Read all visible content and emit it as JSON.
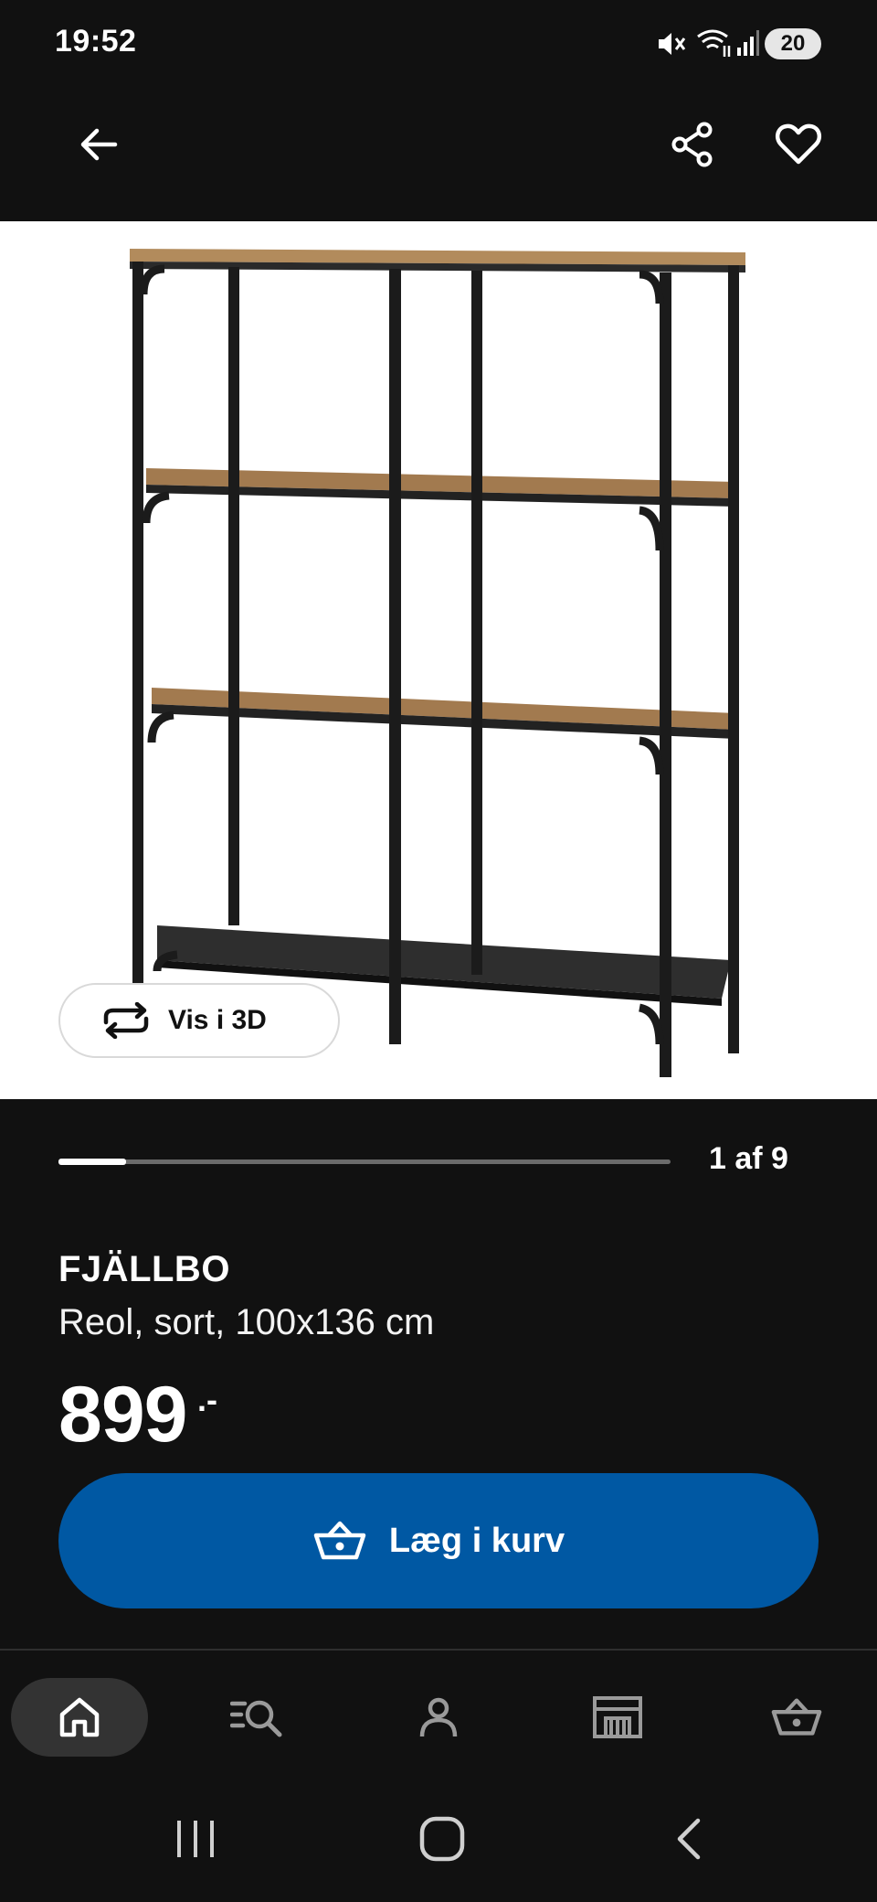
{
  "status_bar": {
    "time": "19:52",
    "battery": "20"
  },
  "top_bar": {
    "back_icon": "arrow-left-icon",
    "share_icon": "share-icon",
    "favorite_icon": "heart-icon"
  },
  "product_image": {
    "alt": "FJÄLLBO",
    "view_3d_label": "Vis i 3D"
  },
  "carousel": {
    "current": 1,
    "total": 9,
    "counter_label": "1 af 9",
    "progress": 0.111
  },
  "product": {
    "name": "FJÄLLBO",
    "description": "Reol, sort, 100x136 cm",
    "price": "899",
    "price_suffix": ".-"
  },
  "add_to_cart": {
    "label": "Læg i kurv",
    "color": "#0058a3"
  },
  "bottom_nav": {
    "items": [
      {
        "name": "home",
        "icon": "home-icon",
        "active": true
      },
      {
        "name": "search",
        "icon": "search-list-icon",
        "active": false
      },
      {
        "name": "profile",
        "icon": "person-icon",
        "active": false
      },
      {
        "name": "stores",
        "icon": "store-icon",
        "active": false
      },
      {
        "name": "cart",
        "icon": "basket-icon",
        "active": false
      }
    ]
  },
  "colors": {
    "background": "#111111",
    "accent": "#0058a3",
    "image_bg": "#ffffff"
  }
}
